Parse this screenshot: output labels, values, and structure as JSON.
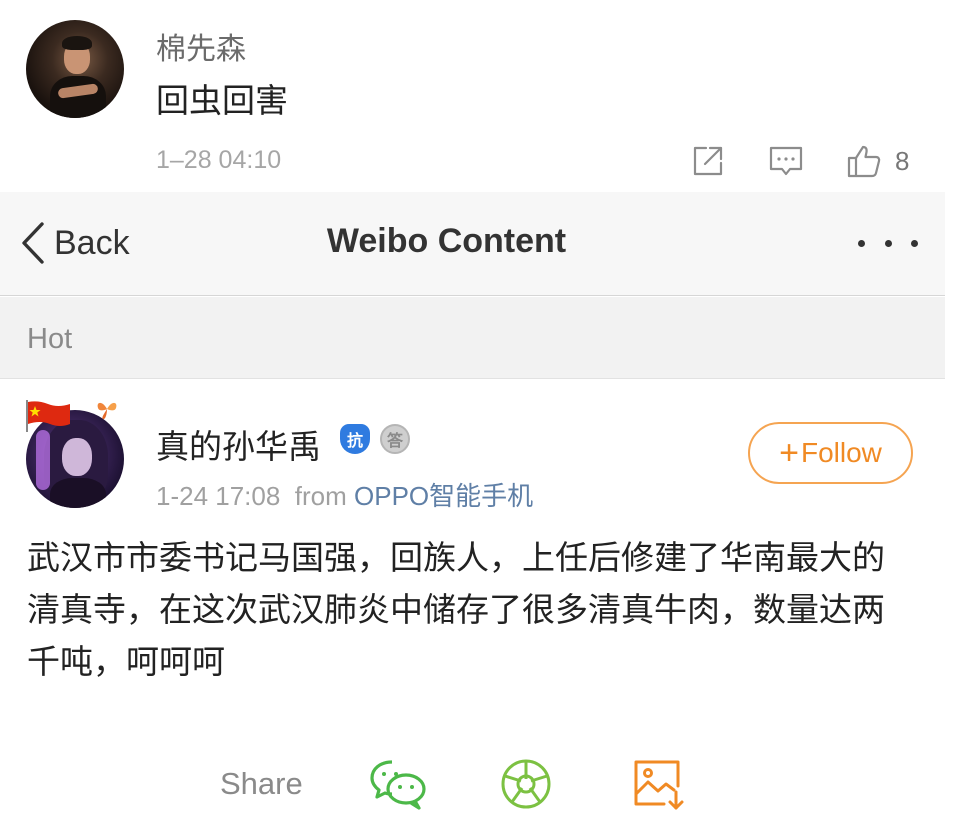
{
  "comment": {
    "username": "棉先森",
    "text": "回虫回害",
    "time": "1–28 04:10",
    "like_count": "8",
    "icons": [
      "share-icon",
      "comment-icon",
      "like-icon"
    ]
  },
  "navbar": {
    "back_label": "Back",
    "title": "Weibo Content",
    "more_icon": "more-icon"
  },
  "section": {
    "label": "Hot"
  },
  "post": {
    "username": "真的孙华禹",
    "badge_kang": "抗",
    "badge_medal": "答",
    "time": "1-24 17:08",
    "from_label": "from",
    "source": "OPPO智能手机",
    "follow_label": "Follow",
    "content": "武汉市市委书记马国强，回族人，上任后修建了华南最大的清真寺，在这次武汉肺炎中储存了很多清真牛肉，数量达两千吨，呵呵呵"
  },
  "share": {
    "label": "Share",
    "targets": [
      "wechat-icon",
      "moments-icon",
      "save-image-icon"
    ]
  },
  "colors": {
    "accent_orange": "#f08a24",
    "wechat_green": "#4cb848",
    "link_blue": "#5f7fa6"
  }
}
